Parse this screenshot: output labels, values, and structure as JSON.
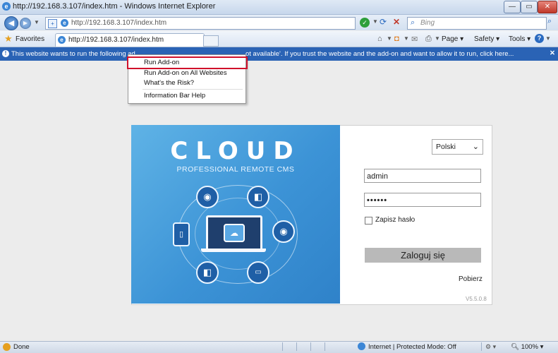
{
  "window": {
    "title": "http://192.168.3.107/index.htm - Windows Internet Explorer"
  },
  "address_bar": {
    "url": "http://192.168.3.107/index.htm",
    "search_placeholder": "Bing"
  },
  "favorites_bar": {
    "favorites_label": "Favorites",
    "tab_title": "http://192.168.3.107/index.htm",
    "page_menu": "Page",
    "safety_menu": "Safety",
    "tools_menu": "Tools"
  },
  "info_bar": {
    "message_part1": "This website wants to run the following ad",
    "message_part2": "ot available'. If you trust the website and the add-on and want to allow it to run, click here..."
  },
  "context_menu": {
    "items": [
      "Run Add-on",
      "Run Add-on on All Websites",
      "What's the Risk?",
      "Information Bar Help"
    ]
  },
  "login_panel": {
    "brand_title": "CLOUD",
    "brand_subtitle": "PROFESSIONAL REMOTE CMS",
    "language": "Polski",
    "username": "admin",
    "password_mask": "••••••",
    "remember_label": "Zapisz hasło",
    "login_button": "Zaloguj się",
    "download_link": "Pobierz",
    "version": "V5.5.0.8"
  },
  "status_bar": {
    "status_text": "Done",
    "zone_text": "Internet | Protected Mode: Off",
    "zoom": "100%"
  },
  "colors": {
    "info_bar": "#2a63b5",
    "menu_highlight": "#d0112b",
    "brand_gradient_start": "#5fb3e6",
    "brand_gradient_end": "#2f82c9",
    "login_button": "#b9b9b9"
  },
  "icons": [
    "ie-logo-icon",
    "back-icon",
    "forward-icon",
    "refresh-icon",
    "stop-icon",
    "search-icon",
    "home-icon",
    "feeds-icon",
    "mail-icon",
    "print-icon",
    "help-icon",
    "camera-icon",
    "tablet-icon",
    "laptop-icon",
    "cloud-icon",
    "dvr-icon"
  ]
}
